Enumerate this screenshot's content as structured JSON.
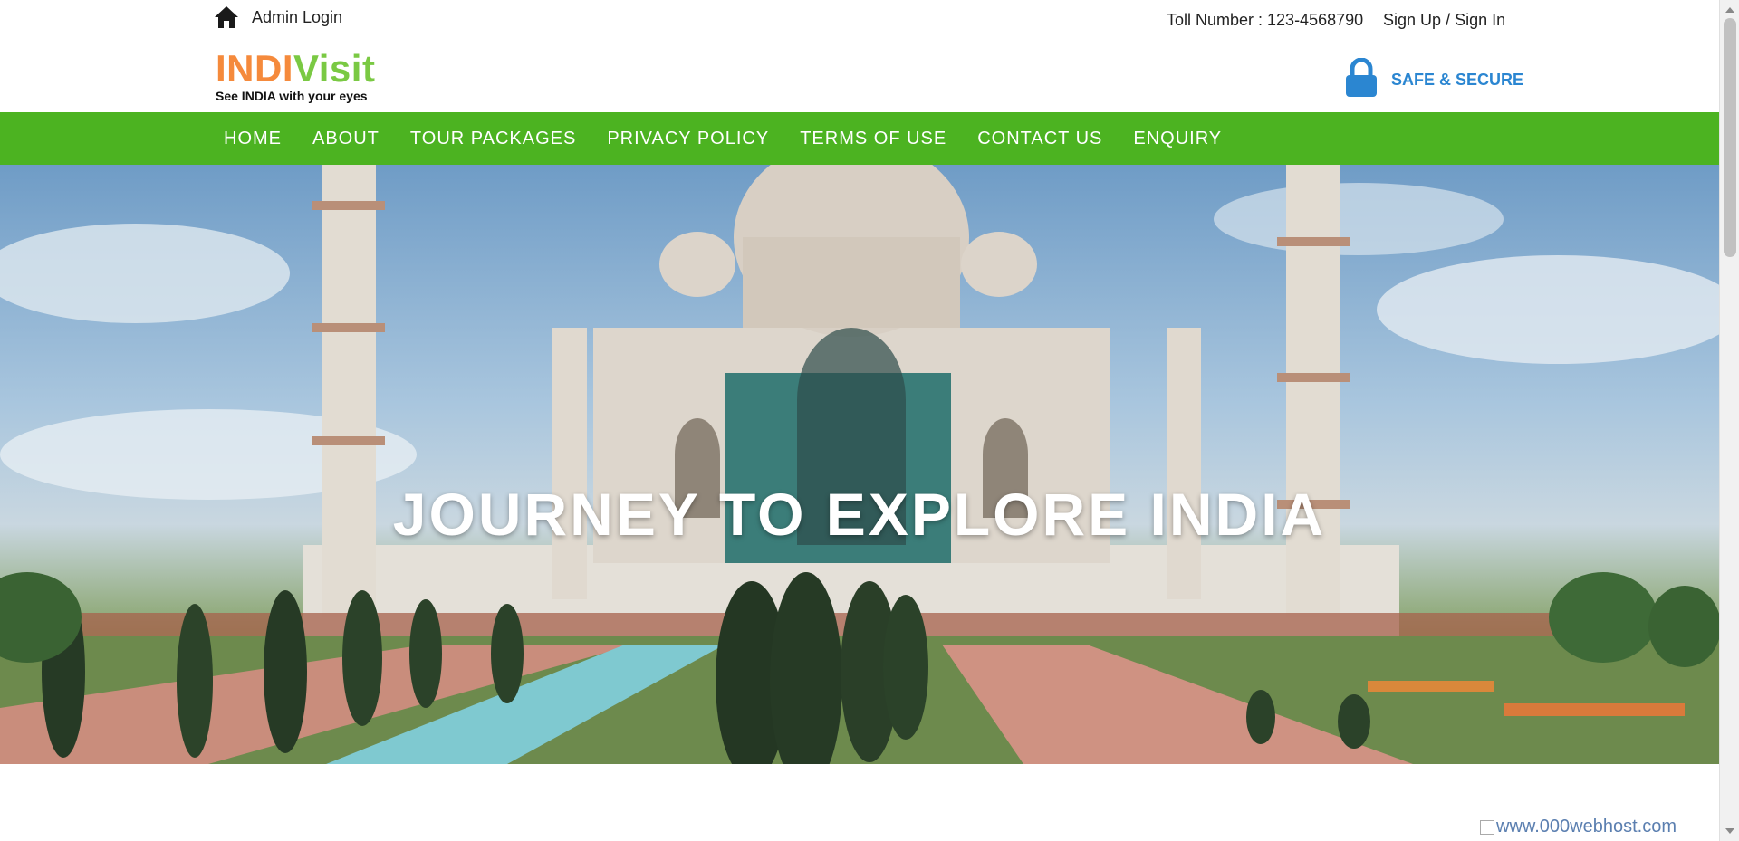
{
  "topbar": {
    "admin_login": "Admin Login",
    "toll_number": "Toll Number : 123-4568790",
    "sign_up": "Sign Up",
    "separator": "/",
    "sign_in": "Sign In",
    "home_icon": "home-icon"
  },
  "brand": {
    "logo_part1": "INDI",
    "logo_part2": "Visit",
    "tagline": "See INDIA with your eyes",
    "color_part1": "#f58a3c",
    "color_part2": "#7ac943"
  },
  "secure": {
    "label": "SAFE & SECURE",
    "icon": "lock-icon",
    "color": "#2b86d1"
  },
  "nav": {
    "color": "#4cb321",
    "items": [
      {
        "label": "HOME"
      },
      {
        "label": "ABOUT"
      },
      {
        "label": "TOUR PACKAGES"
      },
      {
        "label": "PRIVACY POLICY"
      },
      {
        "label": "TERMS OF USE"
      },
      {
        "label": "CONTACT US"
      },
      {
        "label": "ENQUIRY"
      }
    ]
  },
  "hero": {
    "title": "JOURNEY TO EXPLORE INDIA"
  },
  "footer_badge": {
    "alt_text": "www.000webhost.com"
  }
}
